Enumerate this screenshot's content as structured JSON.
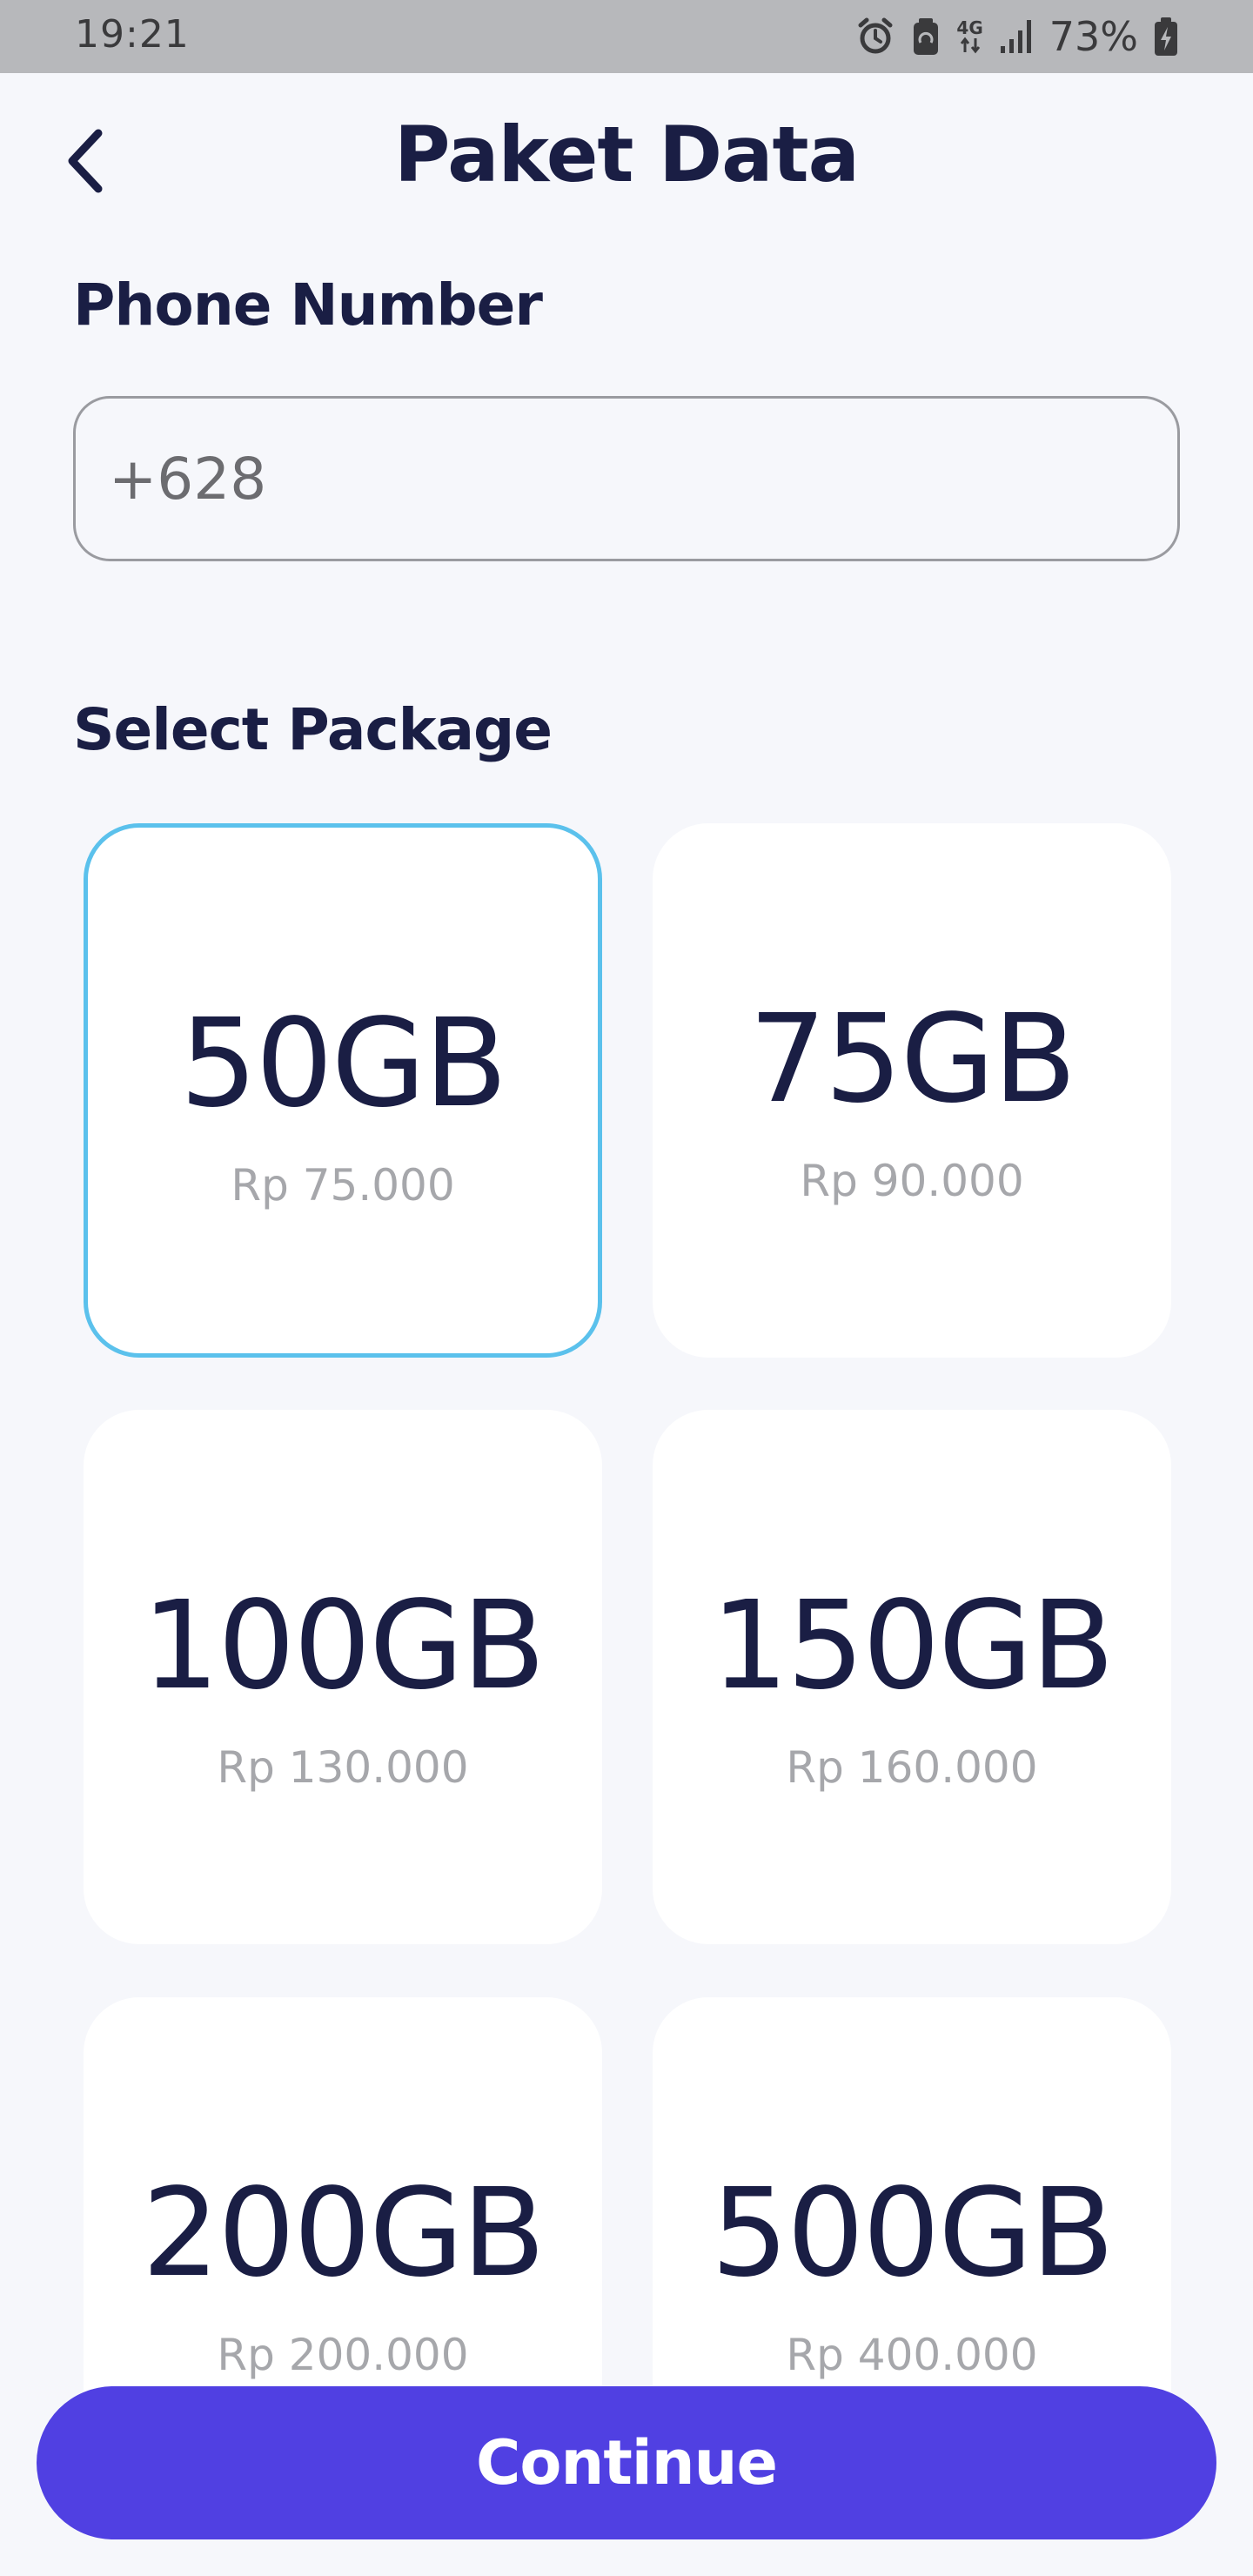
{
  "status_bar": {
    "time": "19:21",
    "network": "4G",
    "battery": "73%",
    "icons": [
      "alarm-icon",
      "battery-saver-icon",
      "network-4g-icon",
      "signal-icon",
      "battery-charging-icon"
    ]
  },
  "header": {
    "title": "Paket Data",
    "back_icon": "chevron-left-icon"
  },
  "phone": {
    "label": "Phone Number",
    "placeholder": "+628",
    "value": ""
  },
  "packages": {
    "label": "Select Package",
    "selected_index": 0,
    "items": [
      {
        "size": "50GB",
        "price": "Rp 75.000"
      },
      {
        "size": "75GB",
        "price": "Rp 90.000"
      },
      {
        "size": "100GB",
        "price": "Rp 130.000"
      },
      {
        "size": "150GB",
        "price": "Rp 160.000"
      },
      {
        "size": "200GB",
        "price": "Rp 200.000"
      },
      {
        "size": "500GB",
        "price": "Rp 400.000"
      }
    ]
  },
  "actions": {
    "continue_label": "Continue"
  },
  "colors": {
    "background": "#F6F7FB",
    "title_text": "#1A1E44",
    "accent_button": "#5040E2",
    "selected_border": "#5BC1EC",
    "price_text": "#A6A7AB",
    "status_bar": "#B7B8BB"
  }
}
